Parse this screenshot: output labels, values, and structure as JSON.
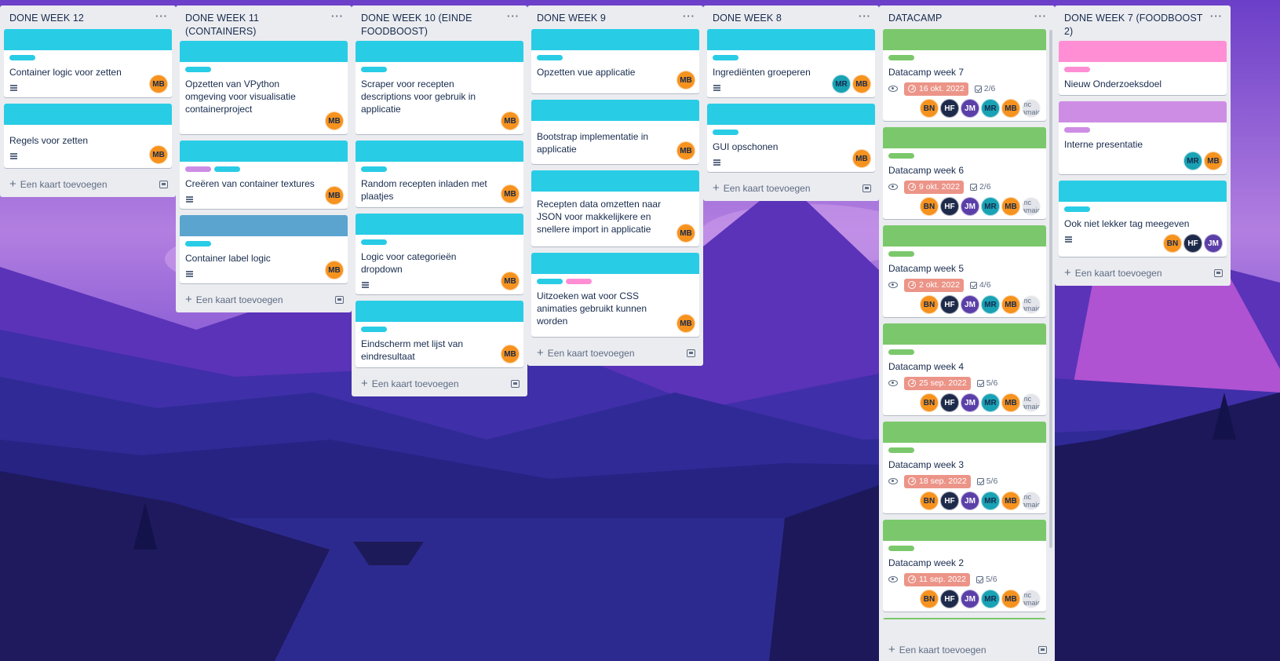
{
  "colors": {
    "cyan": "#29cce5",
    "green": "#7bc86c",
    "pink": "#ff8ed4",
    "purple": "#cd8de5",
    "blue": "#5ba4cf",
    "orange": "#f6921e",
    "date_red": "#ec9488"
  },
  "add_card_label": "Een kaart toevoegen",
  "lists": [
    {
      "title": "DONE WEEK 12",
      "menu": "···",
      "cards": [
        {
          "title": "Container logic voor zetten",
          "members": [
            "MB"
          ]
        },
        {
          "title": "Regels voor zetten",
          "members": [
            "MB"
          ]
        }
      ]
    },
    {
      "title": "DONE WEEK 11 (CONTAINERS)",
      "menu": "···",
      "cards": [
        {
          "title": "Opzetten van VPython omgeving voor visualisatie containerproject",
          "members": [
            "MB"
          ]
        },
        {
          "title": "Creëren van container textures",
          "members": [
            "MB"
          ]
        },
        {
          "title": "Container label logic",
          "members": [
            "MB"
          ]
        }
      ]
    },
    {
      "title": "DONE WEEK 10 (EINDE FOODBOOST)",
      "menu": "···",
      "cards": [
        {
          "title": "Scraper voor recepten descriptions voor gebruik in applicatie",
          "members": [
            "MB"
          ]
        },
        {
          "title": "Random recepten inladen met plaatjes",
          "members": [
            "MB"
          ]
        },
        {
          "title": "Logic voor categorieën dropdown",
          "members": [
            "MB"
          ]
        },
        {
          "title": "Eindscherm met lijst van eindresultaat",
          "members": [
            "MB"
          ]
        }
      ]
    },
    {
      "title": "DONE WEEK 9",
      "menu": "···",
      "cards": [
        {
          "title": "Opzetten vue applicatie",
          "members": [
            "MB"
          ]
        },
        {
          "title": "Bootstrap implementatie in applicatie",
          "members": [
            "MB"
          ]
        },
        {
          "title": "Recepten data omzetten naar JSON voor makkelijkere en snellere import in applicatie",
          "members": [
            "MB"
          ]
        },
        {
          "title": "Uitzoeken wat voor CSS animaties gebruikt kunnen worden",
          "members": [
            "MB"
          ]
        }
      ]
    },
    {
      "title": "DONE WEEK 8",
      "menu": "···",
      "cards": [
        {
          "title": "Ingrediënten groeperen",
          "members": [
            "MR",
            "MB"
          ]
        },
        {
          "title": "GUI opschonen",
          "members": [
            "MB"
          ]
        }
      ]
    },
    {
      "title": "DATACAMP",
      "menu": "···",
      "cards": [
        {
          "title": "Datacamp week 7",
          "due": "16 okt. 2022",
          "checklist": "2/6",
          "members": [
            "BN",
            "HF",
            "JM",
            "MR",
            "MB",
            "mc amaic"
          ]
        },
        {
          "title": "Datacamp week 6",
          "due": "9 okt. 2022",
          "checklist": "2/6",
          "members": [
            "BN",
            "HF",
            "JM",
            "MR",
            "MB",
            "mc amaic"
          ]
        },
        {
          "title": "Datacamp week 5",
          "due": "2 okt. 2022",
          "checklist": "4/6",
          "members": [
            "BN",
            "HF",
            "JM",
            "MR",
            "MB",
            "mc amaic"
          ]
        },
        {
          "title": "Datacamp week 4",
          "due": "25 sep. 2022",
          "checklist": "5/6",
          "members": [
            "BN",
            "HF",
            "JM",
            "MR",
            "MB",
            "mc amaic"
          ]
        },
        {
          "title": "Datacamp week 3",
          "due": "18 sep. 2022",
          "checklist": "5/6",
          "members": [
            "BN",
            "HF",
            "JM",
            "MR",
            "MB",
            "mc amaic"
          ]
        },
        {
          "title": "Datacamp week 2",
          "due": "11 sep. 2022",
          "checklist": "5/6",
          "members": [
            "BN",
            "HF",
            "JM",
            "MR",
            "MB",
            "mc amaic"
          ]
        }
      ]
    },
    {
      "title": "DONE WEEK 7 (FOODBOOST 2)",
      "menu": "···",
      "cards": [
        {
          "title": "Nieuw Onderzoeksdoel",
          "members": []
        },
        {
          "title": "Interne presentatie",
          "members": [
            "MR",
            "MB"
          ]
        },
        {
          "title": "Ook niet lekker tag meegeven",
          "members": [
            "BN",
            "HF",
            "JM"
          ]
        }
      ]
    }
  ]
}
